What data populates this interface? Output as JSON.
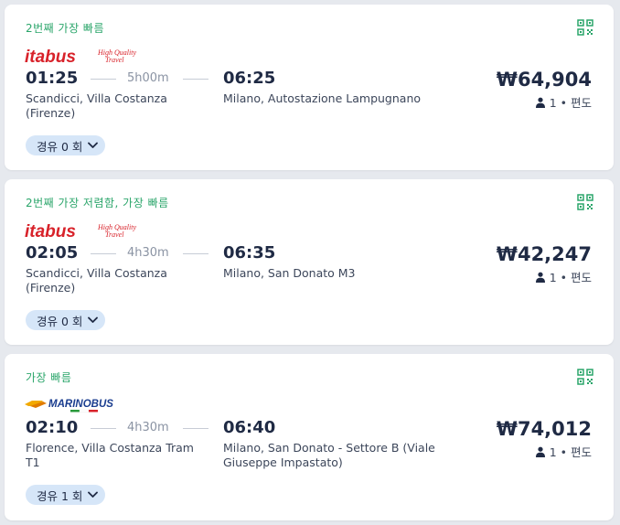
{
  "colors": {
    "tag_green": "#2aa56a",
    "itabus_red": "#d8222a",
    "marino_blue": "#1a3d8f",
    "marino_yellow": "#f2a900",
    "text_dark": "#1f2a44",
    "chip_bg": "#d6e6f8"
  },
  "results": [
    {
      "tag": "2번째 가장 빠름",
      "operator": {
        "logo_text": "itabus",
        "tagline": "High Quality Travel"
      },
      "departure_time": "01:25",
      "duration": "5h00m",
      "arrival_time": "06:25",
      "departure_stop": "Scandicci, Villa Costanza (Firenze)",
      "arrival_stop": "Milano, Autostazione Lampugnano",
      "price": "₩64,904",
      "passengers": "1 • 편도",
      "transfers": "경유 0 회",
      "icons": {
        "qr": "qr-code-icon",
        "person": "person-icon",
        "chevron": "chevron-down-icon"
      }
    },
    {
      "tag": "2번째 가장 저렴함, 가장 빠름",
      "operator": {
        "logo_text": "itabus",
        "tagline": "High Quality Travel"
      },
      "departure_time": "02:05",
      "duration": "4h30m",
      "arrival_time": "06:35",
      "departure_stop": "Scandicci, Villa Costanza (Firenze)",
      "arrival_stop": "Milano, San Donato M3",
      "price": "₩42,247",
      "passengers": "1 • 편도",
      "transfers": "경유 0 회",
      "icons": {
        "qr": "qr-code-icon",
        "person": "person-icon",
        "chevron": "chevron-down-icon"
      }
    },
    {
      "tag": "가장 빠름",
      "operator": {
        "logo_text": "MARINOBUS"
      },
      "departure_time": "02:10",
      "duration": "4h30m",
      "arrival_time": "06:40",
      "departure_stop": "Florence, Villa Costanza Tram T1",
      "arrival_stop": "Milano, San Donato - Settore B (Viale Giuseppe Impastato)",
      "price": "₩74,012",
      "passengers": "1 • 편도",
      "transfers": "경유 1 회",
      "icons": {
        "qr": "qr-code-icon",
        "person": "person-icon",
        "chevron": "chevron-down-icon"
      }
    }
  ]
}
